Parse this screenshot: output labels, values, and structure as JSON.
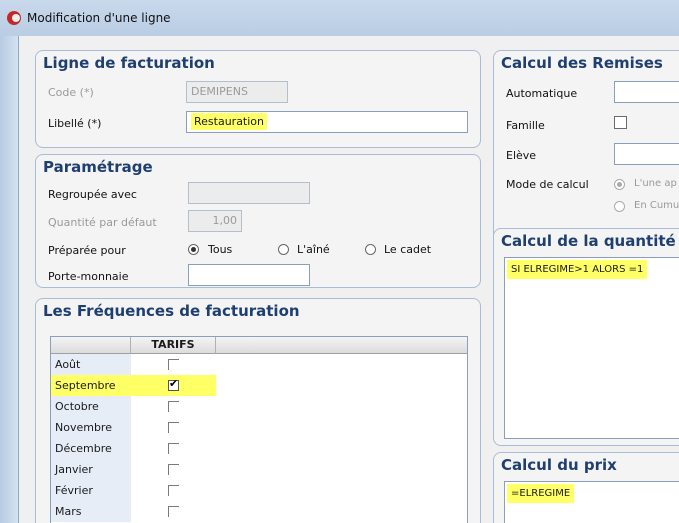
{
  "window": {
    "title": "Modification d'une ligne"
  },
  "ligne": {
    "title": "Ligne de facturation",
    "code_label": "Code (*)",
    "code_value": "DEMIPENS",
    "libelle_label": "Libellé (*)",
    "libelle_value": "Restauration"
  },
  "parametrage": {
    "title": "Paramétrage",
    "regroupee_label": "Regroupée avec",
    "regroupee_value": "",
    "quantite_label": "Quantité par défaut",
    "quantite_value": "1,00",
    "preparee_label": "Préparée pour",
    "options": [
      "Tous",
      "L'aîné",
      "Le cadet"
    ],
    "selected_option": "Tous",
    "porte_label": "Porte-monnaie",
    "porte_value": ""
  },
  "frequences": {
    "title": "Les Fréquences de facturation",
    "column_header": "TARIFS",
    "rows": [
      {
        "month": "Août",
        "checked": false,
        "highlight": false
      },
      {
        "month": "Septembre",
        "checked": true,
        "highlight": true
      },
      {
        "month": "Octobre",
        "checked": false,
        "highlight": false
      },
      {
        "month": "Novembre",
        "checked": false,
        "highlight": false
      },
      {
        "month": "Décembre",
        "checked": false,
        "highlight": false
      },
      {
        "month": "Janvier",
        "checked": false,
        "highlight": false
      },
      {
        "month": "Février",
        "checked": false,
        "highlight": false
      },
      {
        "month": "Mars",
        "checked": false,
        "highlight": false
      }
    ]
  },
  "remises": {
    "title": "Calcul des Remises",
    "automatique_label": "Automatique",
    "famille_label": "Famille",
    "eleve_label": "Elève",
    "mode_label": "Mode de calcul",
    "mode_option1": "L'une ap",
    "mode_option2": "En Cumu"
  },
  "quantite_calc": {
    "title": "Calcul de la quantité",
    "formula": "SI ELREGIME>1 ALORS =1"
  },
  "prix_calc": {
    "title": "Calcul du prix",
    "formula": "=ELREGIME"
  },
  "colors": {
    "highlight": "#ffff66",
    "title_blue": "#1f3f70",
    "frame": "#a7bdd6"
  }
}
